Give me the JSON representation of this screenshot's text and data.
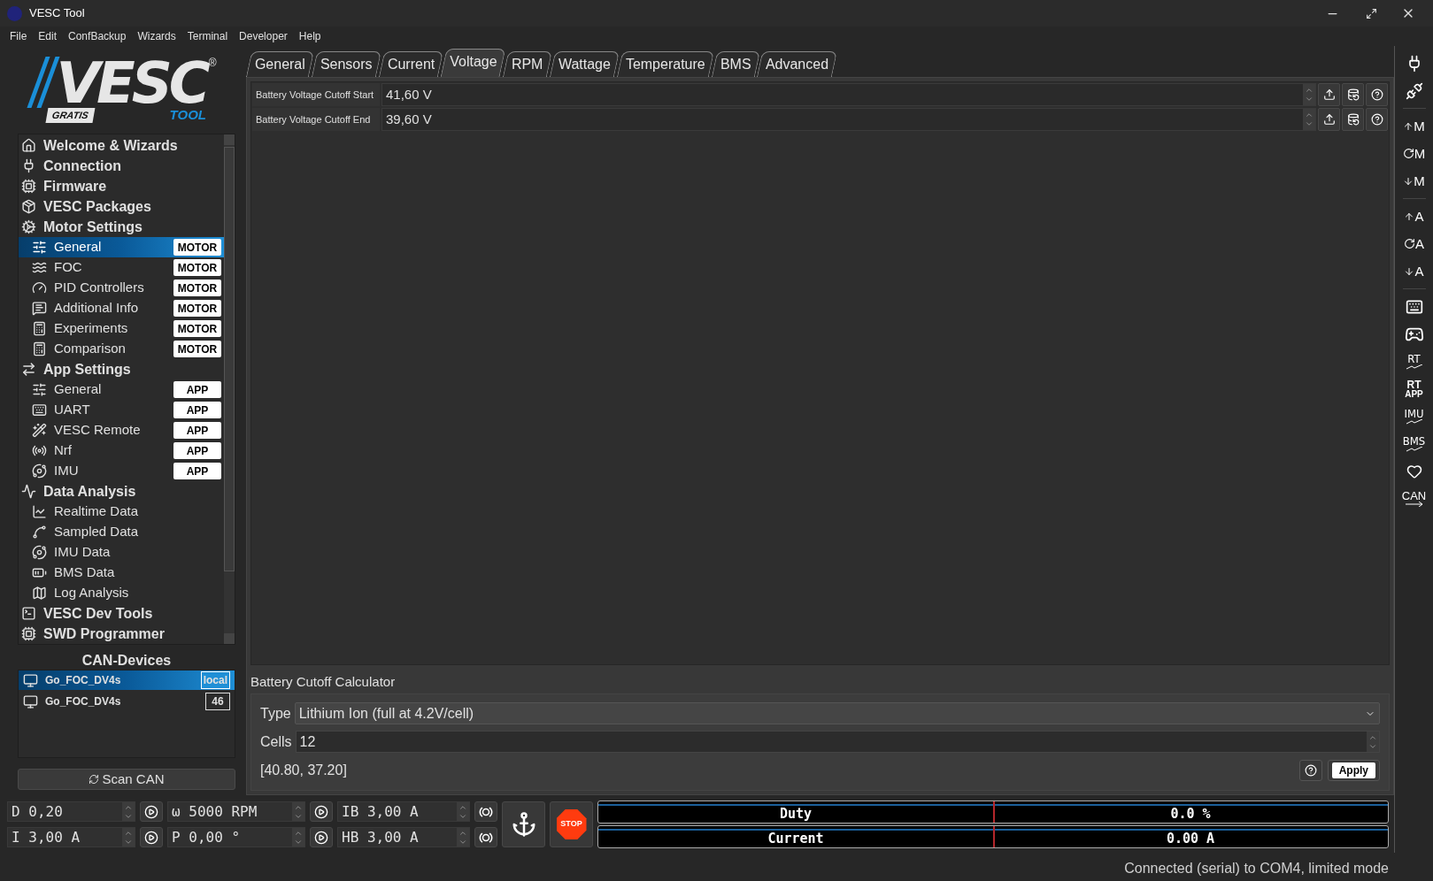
{
  "window": {
    "title": "VESC Tool"
  },
  "menu": [
    "File",
    "Edit",
    "ConfBackup",
    "Wizards",
    "Terminal",
    "Developer",
    "Help"
  ],
  "logo": {
    "wordmark": "VESC",
    "mark": "®",
    "badge": "GRATIS",
    "sub": "TOOL"
  },
  "sidebar": {
    "items": [
      {
        "label": "Welcome & Wizards",
        "selected": false
      },
      {
        "label": "Connection",
        "selected": false
      },
      {
        "label": "Firmware",
        "selected": false
      },
      {
        "label": "VESC Packages",
        "selected": false
      },
      {
        "label": "Motor Settings",
        "selected": false,
        "children": [
          {
            "label": "General",
            "badge": "MOTOR",
            "selected": true
          },
          {
            "label": "FOC",
            "badge": "MOTOR",
            "selected": false
          },
          {
            "label": "PID Controllers",
            "badge": "MOTOR",
            "selected": false
          },
          {
            "label": "Additional Info",
            "badge": "MOTOR",
            "selected": false
          },
          {
            "label": "Experiments",
            "badge": "MOTOR",
            "selected": false
          },
          {
            "label": "Comparison",
            "badge": "MOTOR",
            "selected": false
          }
        ]
      },
      {
        "label": "App Settings",
        "selected": false,
        "children": [
          {
            "label": "General",
            "badge": "APP",
            "selected": false
          },
          {
            "label": "UART",
            "badge": "APP",
            "selected": false
          },
          {
            "label": "VESC Remote",
            "badge": "APP",
            "selected": false
          },
          {
            "label": "Nrf",
            "badge": "APP",
            "selected": false
          },
          {
            "label": "IMU",
            "badge": "APP",
            "selected": false
          }
        ]
      },
      {
        "label": "Data Analysis",
        "selected": false,
        "children": [
          {
            "label": "Realtime Data",
            "selected": false
          },
          {
            "label": "Sampled Data",
            "selected": false
          },
          {
            "label": "IMU Data",
            "selected": false
          },
          {
            "label": "BMS Data",
            "selected": false
          },
          {
            "label": "Log Analysis",
            "selected": false
          }
        ]
      },
      {
        "label": "VESC Dev Tools",
        "selected": false
      },
      {
        "label": "SWD Programmer",
        "selected": false
      }
    ]
  },
  "can_devices": {
    "title": "CAN-Devices",
    "items": [
      {
        "name": "Go_FOC_DV4s",
        "tag": "local",
        "selected": true
      },
      {
        "name": "Go_FOC_DV4s",
        "tag": "46",
        "selected": false
      }
    ],
    "scan_button": "Scan CAN"
  },
  "tabs": [
    {
      "label": "General",
      "selected": false
    },
    {
      "label": "Sensors",
      "selected": false
    },
    {
      "label": "Current",
      "selected": false
    },
    {
      "label": "Voltage",
      "selected": true
    },
    {
      "label": "RPM",
      "selected": false
    },
    {
      "label": "Wattage",
      "selected": false
    },
    {
      "label": "Temperature",
      "selected": false
    },
    {
      "label": "BMS",
      "selected": false
    },
    {
      "label": "Advanced",
      "selected": false
    }
  ],
  "parameters": [
    {
      "label": "Battery Voltage Cutoff Start",
      "value": "41,60 V"
    },
    {
      "label": "Battery Voltage Cutoff End",
      "value": "39,60 V"
    }
  ],
  "calculator": {
    "title": "Battery Cutoff Calculator",
    "type_label": "Type",
    "type_value": "Lithium Ion (full at 4.2V/cell)",
    "cells_label": "Cells",
    "cells_value": "12",
    "result": "[40.80, 37.20]",
    "apply_button": "Apply"
  },
  "controls": [
    {
      "value": "D 0,20",
      "kind": "play"
    },
    {
      "value": "ω 5000 RPM",
      "kind": "play"
    },
    {
      "value": "IB 3,00 A",
      "kind": "brake"
    },
    {
      "value": "I 3,00 A",
      "kind": "play"
    },
    {
      "value": "P 0,00 °",
      "kind": "play"
    },
    {
      "value": "HB 3,00 A",
      "kind": "brake"
    }
  ],
  "stop_button": "STOP",
  "meters": [
    {
      "label": "Duty",
      "value": "0.0 %"
    },
    {
      "label": "Current",
      "value": "0.00 A"
    }
  ],
  "toolbar": [
    {
      "kind": "connect"
    },
    {
      "kind": "disconnect"
    },
    {
      "kind": "divider"
    },
    {
      "kind": "write",
      "label": "M"
    },
    {
      "kind": "read",
      "label": "M"
    },
    {
      "kind": "default",
      "label": "M"
    },
    {
      "kind": "divider"
    },
    {
      "kind": "write",
      "label": "A"
    },
    {
      "kind": "read",
      "label": "A"
    },
    {
      "kind": "default",
      "label": "A"
    },
    {
      "kind": "divider"
    },
    {
      "kind": "keys"
    },
    {
      "kind": "gamepad"
    },
    {
      "kind": "plot",
      "label": "RT"
    },
    {
      "kind": "stacked",
      "label": "RT",
      "sub": "APP"
    },
    {
      "kind": "plot",
      "label": "IMU"
    },
    {
      "kind": "plot",
      "label": "BMS"
    },
    {
      "kind": "heart"
    },
    {
      "kind": "arrow",
      "label": "CAN"
    }
  ],
  "status_bar": "Connected (serial) to COM4, limited mode"
}
